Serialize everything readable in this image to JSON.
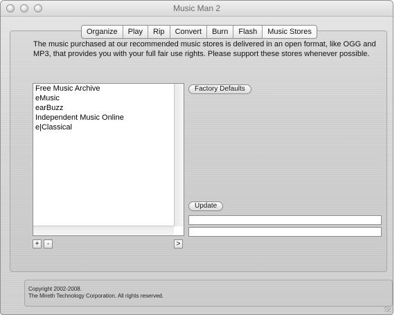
{
  "window": {
    "title": "Music Man 2"
  },
  "tabs": [
    {
      "label": "Organize"
    },
    {
      "label": "Play"
    },
    {
      "label": "Rip"
    },
    {
      "label": "Convert"
    },
    {
      "label": "Burn"
    },
    {
      "label": "Flash"
    },
    {
      "label": "Music Stores",
      "selected": true
    }
  ],
  "description": "The music purchased at our recommended music stores is delivered in an open format, like OGG and MP3, that provides you with your full fair use rights.  Please support these stores whenever possible.",
  "stores": [
    "Free Music Archive",
    "eMusic",
    "earBuzz",
    "Independent Music Online",
    "e|Classical"
  ],
  "buttons": {
    "add": "+",
    "remove": "-",
    "go": ">",
    "factory_defaults": "Factory Defaults",
    "update": "Update"
  },
  "fields": {
    "name_value": "",
    "url_value": ""
  },
  "footer": {
    "line1": "Copyright 2002-2008.",
    "line2": "The Mireth Technology Corporation. All rights reserved."
  }
}
